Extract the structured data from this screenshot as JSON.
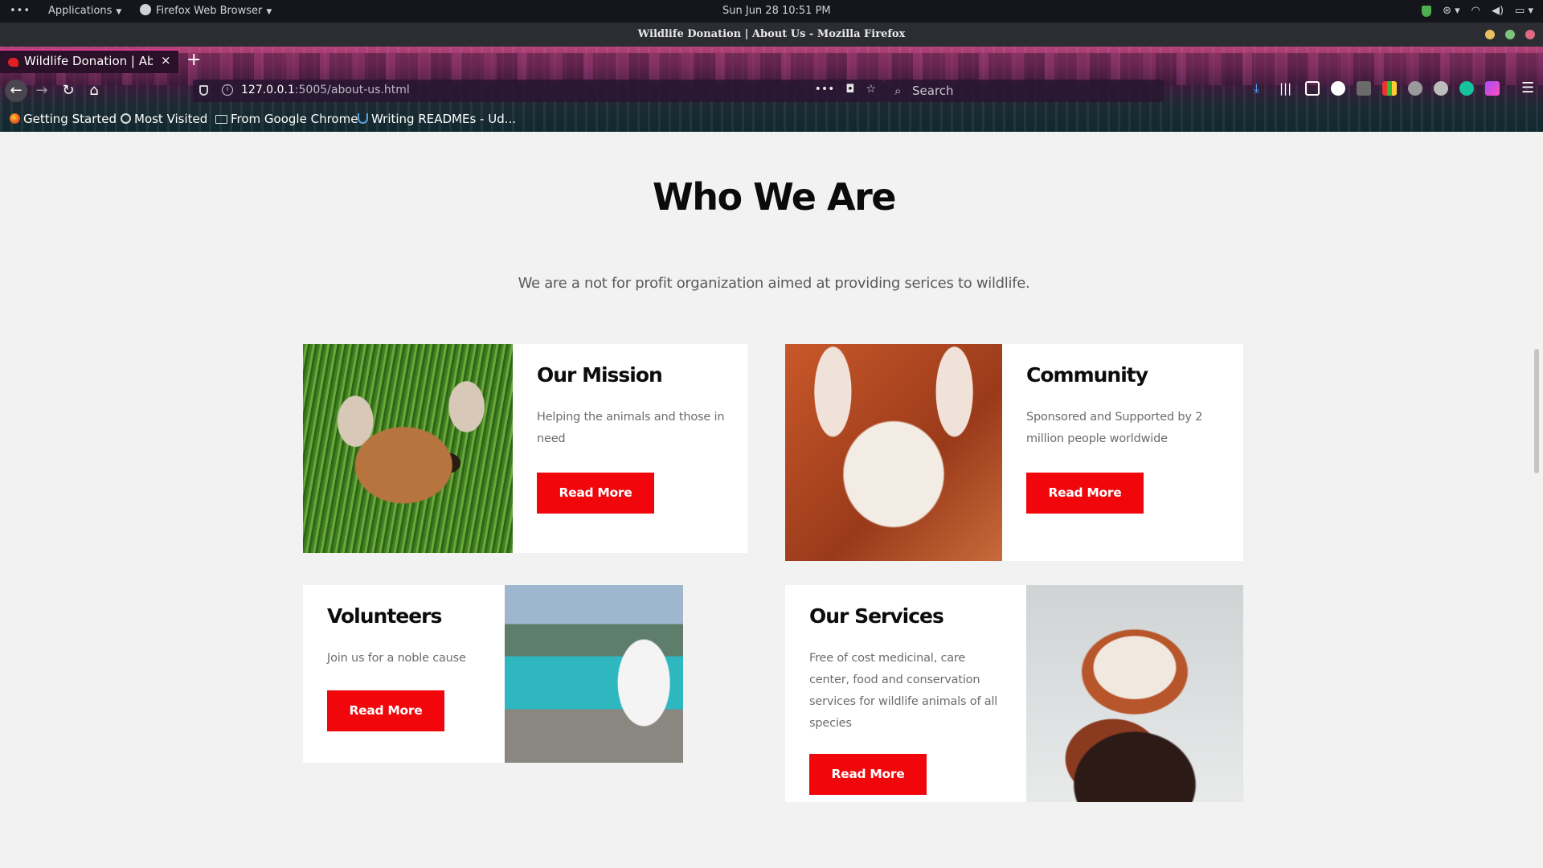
{
  "system_bar": {
    "activities_icon": "dots-icon",
    "applications": "Applications",
    "active_app": "Firefox Web Browser",
    "clock": "Sun Jun 28  10:51 PM",
    "tray_icons": [
      "shield-icon",
      "accessibility-icon",
      "wifi-icon",
      "volume-icon",
      "battery-icon"
    ]
  },
  "window": {
    "title": "Wildlife Donation | About Us - Mozilla Firefox",
    "controls": {
      "minimize_color": "#f0c040",
      "maximize_color": "#4cc44c",
      "close_color": "#e0506a"
    }
  },
  "browser": {
    "tab_label": "Wildlife Donation | Abo",
    "tab_close": "×",
    "new_tab": "+",
    "url_host": "127.0.0.1",
    "url_path": ":5005/about-us.html",
    "search_placeholder": "Search",
    "bookmarks": [
      "Getting Started",
      "Most Visited",
      "From Google Chrome",
      "Writing READMEs - Ud..."
    ]
  },
  "page": {
    "heading": "Who We Are",
    "intro": "We are a not for profit organization aimed at providing serices to wildlife.",
    "cards": [
      {
        "title": "Our Mission",
        "text": "Helping the animals and those in need",
        "button": "Read More",
        "image": "fawn-in-grass"
      },
      {
        "title": "Community",
        "text": "Sponsored and Supported by 2 million people worldwide",
        "button": "Read More",
        "image": "fennec-fox"
      },
      {
        "title": "Volunteers",
        "text": "Join us for a noble cause",
        "button": "Read More",
        "image": "white-wolf-by-lake"
      },
      {
        "title": "Our Services",
        "text": "Free of cost medicinal, care center, food and conservation services for wildlife animals of all species",
        "button": "Read More",
        "image": "red-panda"
      }
    ]
  },
  "colors": {
    "accent_button": "#f0060b",
    "page_background": "#f2f2f2",
    "card_background": "#ffffff"
  }
}
